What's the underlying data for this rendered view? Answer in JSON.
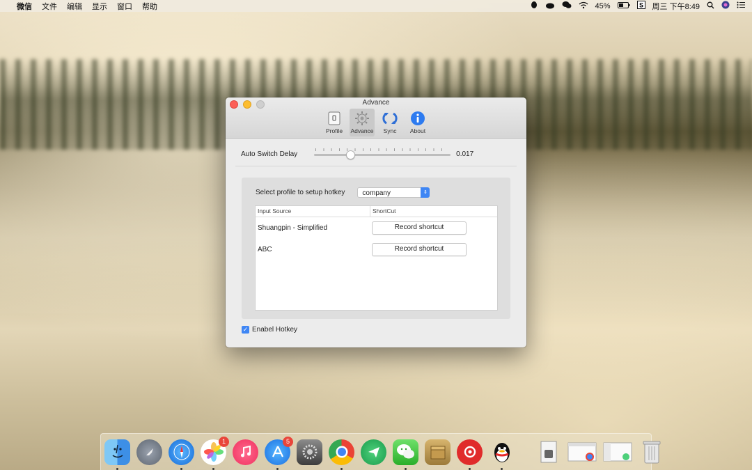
{
  "menubar": {
    "app_name": "微信",
    "menus": [
      "文件",
      "编辑",
      "显示",
      "窗口",
      "帮助"
    ],
    "battery": "45%",
    "datetime": "周三 下午8:49"
  },
  "window": {
    "title": "Advance",
    "toolbar": [
      {
        "label": "Profile",
        "icon": "profile-icon"
      },
      {
        "label": "Advance",
        "icon": "gear-icon"
      },
      {
        "label": "Sync",
        "icon": "sync-icon"
      },
      {
        "label": "About",
        "icon": "info-icon"
      }
    ],
    "delay": {
      "label": "Auto Switch Delay",
      "value": "0.017",
      "fraction": 0.25
    },
    "profile": {
      "label": "Select profile to setup hotkey",
      "selected": "company"
    },
    "table": {
      "headers": [
        "Input Source",
        "ShortCut"
      ],
      "rows": [
        {
          "source": "Shuangpin - Simplified",
          "action": "Record shortcut"
        },
        {
          "source": "ABC",
          "action": "Record shortcut"
        }
      ]
    },
    "hotkey": {
      "label": "Enabel Hotkey",
      "checked": true
    }
  },
  "dock": {
    "badges": {
      "photos": "1",
      "appstore": "5"
    }
  }
}
